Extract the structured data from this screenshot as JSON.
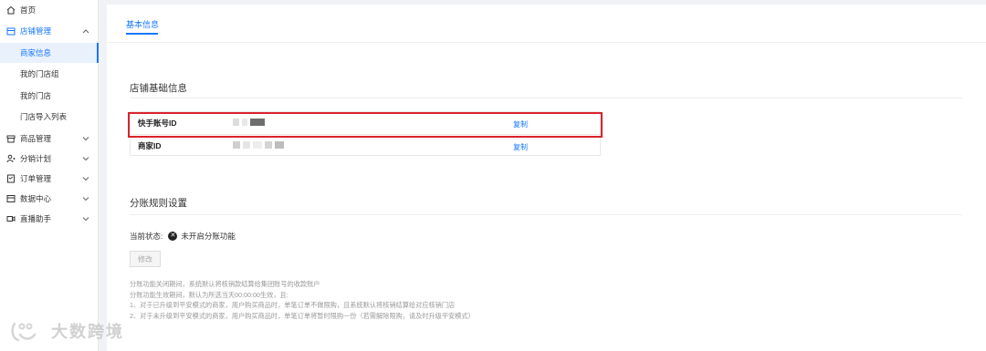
{
  "sidebar": {
    "items": [
      {
        "label": "首页",
        "icon": "home-icon",
        "has_chevron": false
      },
      {
        "label": "店铺管理",
        "icon": "store-icon",
        "has_chevron": true,
        "expanded": true
      },
      {
        "label": "商品管理",
        "icon": "box-icon",
        "has_chevron": true
      },
      {
        "label": "分销计划",
        "icon": "user-share-icon",
        "has_chevron": true
      },
      {
        "label": "订单管理",
        "icon": "order-icon",
        "has_chevron": true
      },
      {
        "label": "数据中心",
        "icon": "data-icon",
        "has_chevron": true
      },
      {
        "label": "直播助手",
        "icon": "video-icon",
        "has_chevron": true
      }
    ],
    "store_sub_items": [
      "商家信息",
      "我的门店组",
      "我的门店",
      "门店导入列表"
    ],
    "selected_sub_item": "商家信息"
  },
  "main": {
    "tab_label": "基本信息",
    "store_section": {
      "title": "店铺基础信息",
      "rows": [
        {
          "key": "快手账号ID",
          "copy_label": "复制"
        },
        {
          "key": "商家ID",
          "copy_label": "复制"
        }
      ]
    },
    "split_section": {
      "title": "分账规则设置",
      "status_label": "当前状态:",
      "status_value": "未开启分账功能",
      "edit_button": "修改",
      "notes": [
        "分账功能关闭期间，系统默认将核销款结算给集团账号的收款账户",
        "分账功能生效期间，默认为所选当天00:00:00生效，且:",
        "1、对于已升级到平安模式的商家，用户购买商品时，单笔订单不做限购，且系统默认将核销结算给对应核销门店",
        "2、对于未升级到平安模式的商家，用户购买商品时，单笔订单将暂时限购一份（若需解除限购，请及时升级平安模式）"
      ]
    }
  },
  "watermark": {
    "text": "大数跨境",
    "icon": "watermark-logo-icon"
  },
  "colors": {
    "accent": "#1677ff",
    "highlight": "#d9232c",
    "selected_bg": "#e9f1fd"
  }
}
